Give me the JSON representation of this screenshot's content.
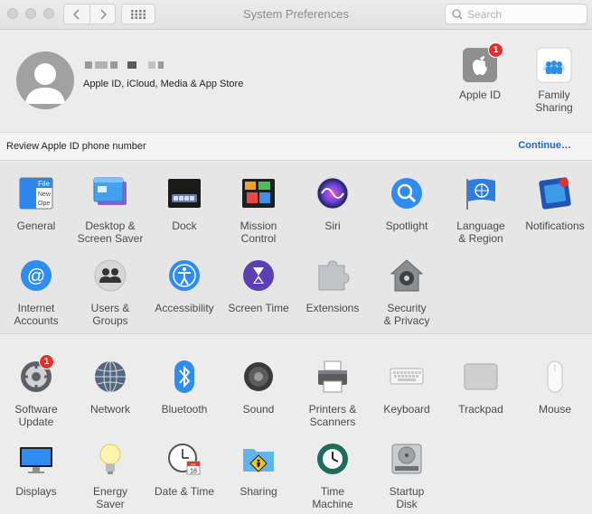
{
  "window": {
    "title": "System Preferences"
  },
  "search": {
    "placeholder": "Search"
  },
  "account": {
    "subtitle": "Apple ID, iCloud, Media & App Store",
    "apple_id_label": "Apple ID",
    "apple_id_badge": "1",
    "family_label_1": "Family",
    "family_label_2": "Sharing"
  },
  "notice": {
    "message": "Review Apple ID phone number",
    "action": "Continue…"
  },
  "section1": [
    {
      "l1": "General",
      "l2": ""
    },
    {
      "l1": "Desktop &",
      "l2": "Screen Saver"
    },
    {
      "l1": "Dock",
      "l2": ""
    },
    {
      "l1": "Mission",
      "l2": "Control"
    },
    {
      "l1": "Siri",
      "l2": ""
    },
    {
      "l1": "Spotlight",
      "l2": ""
    },
    {
      "l1": "Language",
      "l2": "& Region"
    },
    {
      "l1": "Notifications",
      "l2": ""
    },
    {
      "l1": "Internet",
      "l2": "Accounts"
    },
    {
      "l1": "Users &",
      "l2": "Groups"
    },
    {
      "l1": "Accessibility",
      "l2": ""
    },
    {
      "l1": "Screen Time",
      "l2": ""
    },
    {
      "l1": "Extensions",
      "l2": ""
    },
    {
      "l1": "Security",
      "l2": "& Privacy"
    }
  ],
  "section2": [
    {
      "l1": "Software",
      "l2": "Update",
      "badge": "1"
    },
    {
      "l1": "Network",
      "l2": ""
    },
    {
      "l1": "Bluetooth",
      "l2": ""
    },
    {
      "l1": "Sound",
      "l2": ""
    },
    {
      "l1": "Printers &",
      "l2": "Scanners"
    },
    {
      "l1": "Keyboard",
      "l2": ""
    },
    {
      "l1": "Trackpad",
      "l2": ""
    },
    {
      "l1": "Mouse",
      "l2": ""
    },
    {
      "l1": "Displays",
      "l2": ""
    },
    {
      "l1": "Energy",
      "l2": "Saver"
    },
    {
      "l1": "Date & Time",
      "l2": ""
    },
    {
      "l1": "Sharing",
      "l2": ""
    },
    {
      "l1": "Time",
      "l2": "Machine"
    },
    {
      "l1": "Startup",
      "l2": "Disk"
    }
  ],
  "icons": {
    "general": "general-icon",
    "desktop": "desktop-screensaver-icon",
    "dock": "dock-icon",
    "mission": "mission-control-icon",
    "siri": "siri-icon",
    "spotlight": "spotlight-icon",
    "language": "language-region-icon",
    "notifications": "notifications-icon"
  },
  "calendar": {
    "month": "JUL",
    "day": "18"
  },
  "colors": {
    "accent": "#1a64d6",
    "badge": "#e8302a"
  }
}
